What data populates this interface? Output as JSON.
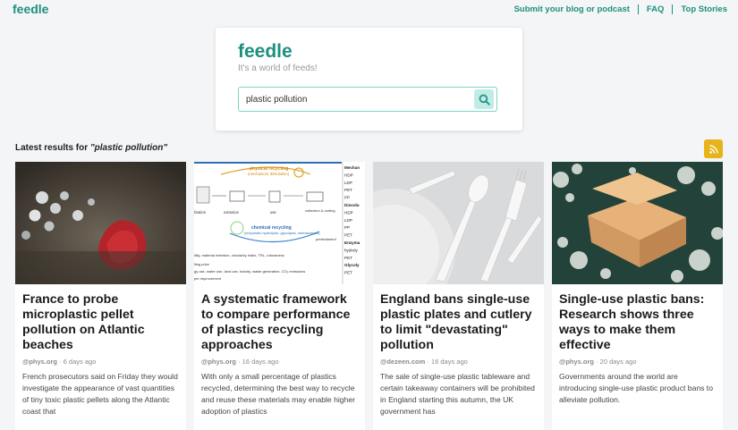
{
  "header": {
    "logo": "feedle",
    "nav": [
      {
        "label": "Submit your blog or podcast"
      },
      {
        "label": "FAQ"
      },
      {
        "label": "Top Stories"
      }
    ]
  },
  "search": {
    "brand": "feedle",
    "tagline": "It's a world of feeds!",
    "query": "plastic pollution",
    "button_icon": "search-icon"
  },
  "results": {
    "label_prefix": "Latest results for",
    "query_display": "\"plastic pollution\"",
    "rss_icon": "rss-icon"
  },
  "cards": [
    {
      "title": "France to probe microplastic pellet pollution on Atlantic beaches",
      "source": "@phys.org",
      "age": "6 days ago",
      "summary": "French prosecutors said on Friday they would investigate the appearance of vast quantities of tiny toxic plastic pellets along the Atlantic coast that"
    },
    {
      "title": "A systematic framework to compare performance of plastics recycling approaches",
      "source": "@phys.org",
      "age": "16 days ago",
      "summary": "With only a small percentage of plastics recycled, determining the best way to recycle and reuse these materials may enable higher adoption of plastics",
      "figure": {
        "physical": "physical recycling",
        "physical_sub": "(mechanical, dissolution)",
        "chemical": "chemical recycling",
        "chemical_sub": "(enzymatic hydrolysis, glycolysis, methanolysis)",
        "extrusion": "extrusion",
        "use": "use",
        "collection": "collection & sorting",
        "pretreatment": "pretreatment",
        "lizatation": "lization",
        "metrics": "illity, material retention, circularity index, TRL, robustness",
        "price": "lling price",
        "impact": "gy use, water use, land use, toxicity, waste generation, CO₂ emissions",
        "impact2": "per improvement",
        "side": [
          "Mechan",
          "HDP",
          "LDP",
          "PET",
          "PP",
          "Dissolu",
          "HDP",
          "LDP",
          "PP",
          "PET",
          "Enzyma",
          "hydroly",
          "PET",
          "Glycoly",
          "PET"
        ]
      }
    },
    {
      "title": "England bans single-use plastic plates and cutlery to limit \"devastating\" pollution",
      "source": "@dezeen.com",
      "age": "16 days ago",
      "summary": "The sale of single-use plastic tableware and certain takeaway containers will be prohibited in England starting this autumn, the UK government has"
    },
    {
      "title": "Single-use plastic bans: Research shows three ways to make them effective",
      "source": "@phys.org",
      "age": "20 days ago",
      "summary": "Governments around the world are introducing single-use plastic product bans to alleviate pollution."
    }
  ]
}
